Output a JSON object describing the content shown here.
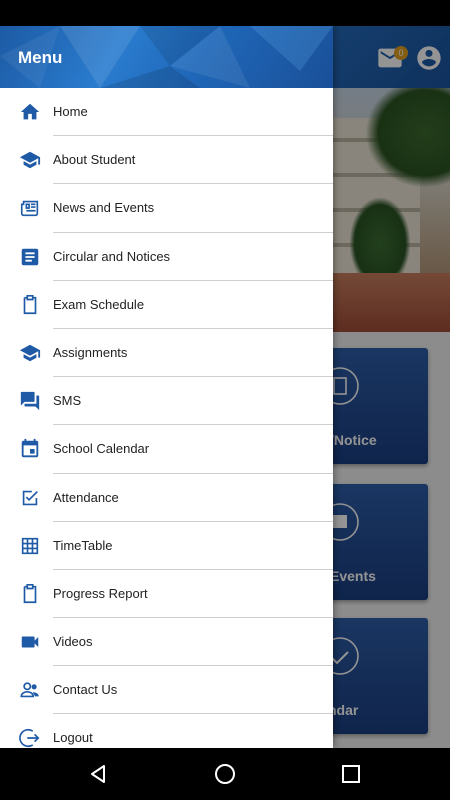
{
  "drawer": {
    "title": "Menu",
    "items": [
      {
        "label": "Home",
        "icon": "home-icon"
      },
      {
        "label": "About Student",
        "icon": "school-icon"
      },
      {
        "label": "News and Events",
        "icon": "newspaper-icon"
      },
      {
        "label": "Circular and Notices",
        "icon": "notice-icon"
      },
      {
        "label": "Exam Schedule",
        "icon": "clipboard-icon"
      },
      {
        "label": "Assignments",
        "icon": "school-icon"
      },
      {
        "label": "SMS",
        "icon": "chat-icon"
      },
      {
        "label": "School Calendar",
        "icon": "calendar-icon"
      },
      {
        "label": "Attendance",
        "icon": "checkbox-icon"
      },
      {
        "label": "TimeTable",
        "icon": "grid-icon"
      },
      {
        "label": "Progress Report",
        "icon": "clipboard-icon"
      },
      {
        "label": "Videos",
        "icon": "video-icon"
      },
      {
        "label": "Contact Us",
        "icon": "contacts-icon"
      },
      {
        "label": "Logout",
        "icon": "logout-icon"
      }
    ]
  },
  "header": {
    "mail_badge": "0"
  },
  "tiles": [
    {
      "label": "/Notice",
      "icon": "notice-icon"
    },
    {
      "label": "Events",
      "icon": "calendar-icon"
    },
    {
      "label": "ndar",
      "icon": "calendar-icon"
    }
  ],
  "colors": {
    "primary": "#1e5fa8",
    "icon": "#1f5aa6",
    "tile": "#23498f"
  }
}
